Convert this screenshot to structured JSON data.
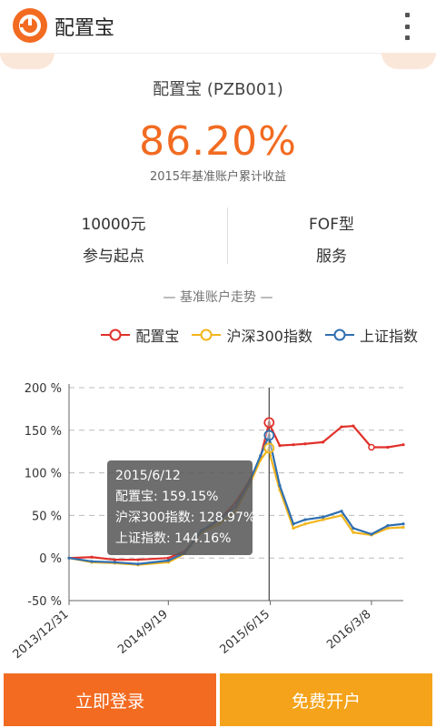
{
  "app": {
    "title": "配置宝"
  },
  "fund": {
    "name": "配置宝 (PZB001)",
    "return_value": "86.20%",
    "return_label": "2015年基准账户累计收益"
  },
  "stats": [
    {
      "value": "10000元",
      "label": "参与起点"
    },
    {
      "value": "FOF型",
      "label": "服务"
    }
  ],
  "section": {
    "title": "— 基准账户走势 —"
  },
  "chart_data": {
    "type": "line",
    "ylim": [
      -50,
      200
    ],
    "yticks": [
      "200 %",
      "150 %",
      "100 %",
      "50 %",
      "0 %",
      "-50 %"
    ],
    "ytick_values": [
      200,
      150,
      100,
      50,
      0,
      -50
    ],
    "xtick_labels": [
      "2013/12/31",
      "2014/9/19",
      "2015/6/15",
      "2016/3/8"
    ],
    "x": [
      "2013/12/31",
      "2014/3/1",
      "2014/5/1",
      "2014/7/1",
      "2014/9/19",
      "2014/11/1",
      "2014/12/15",
      "2015/2/1",
      "2015/3/15",
      "2015/4/20",
      "2015/5/20",
      "2015/6/12",
      "2015/6/15",
      "2015/7/10",
      "2015/8/15",
      "2015/9/15",
      "2015/11/1",
      "2015/12/20",
      "2016/1/20",
      "2016/3/8",
      "2016/4/20",
      "2016/5/31"
    ],
    "series": [
      {
        "name": "配置宝",
        "color": "#e0312a",
        "values": [
          0,
          1,
          -2,
          -2,
          0,
          8,
          30,
          45,
          65,
          90,
          118,
          159,
          155,
          132,
          133,
          134,
          136,
          154,
          155,
          130,
          130,
          133
        ]
      },
      {
        "name": "沪深300指数",
        "color": "#f2b51c",
        "values": [
          0,
          -5,
          -6,
          -8,
          -5,
          5,
          30,
          40,
          55,
          85,
          115,
          129,
          120,
          80,
          35,
          40,
          45,
          50,
          30,
          27,
          35,
          36
        ]
      },
      {
        "name": "上证指数",
        "color": "#2f6fb0",
        "values": [
          0,
          -4,
          -5,
          -7,
          -3,
          6,
          32,
          45,
          60,
          88,
          120,
          144,
          135,
          85,
          40,
          45,
          48,
          55,
          35,
          28,
          38,
          40
        ]
      }
    ],
    "tooltip": {
      "date": "2015/6/12",
      "lines": [
        "配置宝: 159.15%",
        "沪深300指数: 128.97%",
        "上证指数: 144.16%"
      ]
    },
    "grid": true
  },
  "buttons": {
    "login": "立即登录",
    "open_account": "免费开户"
  }
}
